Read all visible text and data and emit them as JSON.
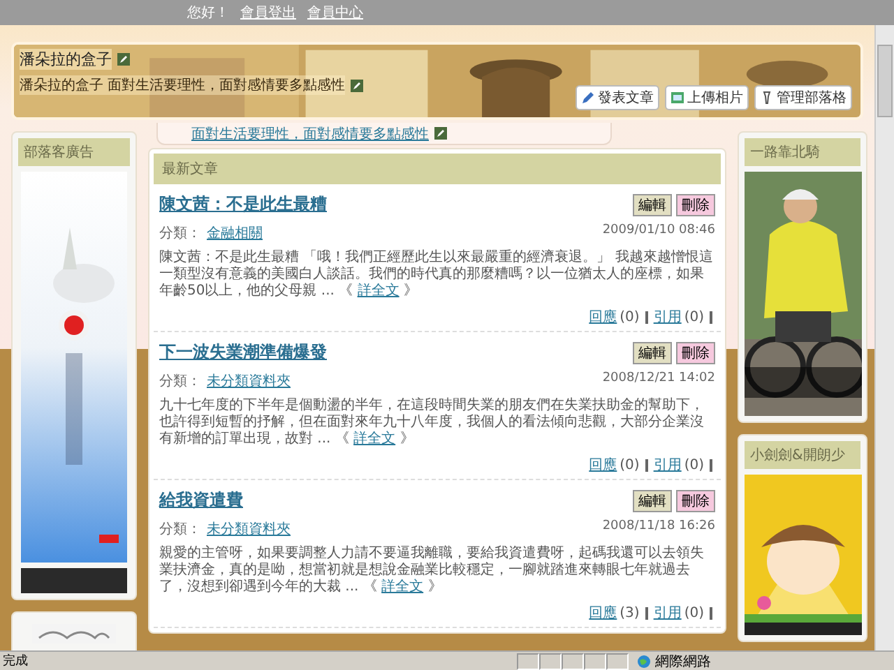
{
  "top_bar": {
    "greeting": "您好！",
    "links": [
      "會員登出",
      "會員中心"
    ]
  },
  "banner": {
    "title": "潘朵拉的盒子",
    "subtitle": "潘朵拉的盒子 面對生活要理性，面對感情要多點感性",
    "buttons": [
      {
        "label": "發表文章"
      },
      {
        "label": "上傳相片"
      },
      {
        "label": "管理部落格"
      }
    ]
  },
  "motto": {
    "link": "面對生活要理性，面對感情要多點感性"
  },
  "left_sidebar": {
    "modules": [
      {
        "title": "部落客廣告"
      }
    ]
  },
  "articles": {
    "title": "最新文章",
    "posts": [
      {
        "title": "陳文茜：不是此生最糟",
        "edit": "編輯",
        "delete": "刪除",
        "category_label": "分類：",
        "category": "金融相關",
        "date": "2009/01/10 08:46",
        "excerpt": "陳文茜：不是此生最糟 「哦！我們正經歷此生以來最嚴重的經濟衰退。」 我越來越憎恨這一類型沒有意義的美國白人談話。我們的時代真的那麼糟嗎？以一位猶太人的座標，如果年齡50以上，他的父母親 ...",
        "more_open": "《",
        "more": "詳全文",
        "more_close": "》",
        "replies": "回應",
        "reply_count": "(0)",
        "trackbacks": "引用",
        "trackback_count": "(0)"
      },
      {
        "title": "下一波失業潮準備爆發",
        "edit": "編輯",
        "delete": "刪除",
        "category_label": "分類：",
        "category": "未分類資料夾",
        "date": "2008/12/21 14:02",
        "excerpt": "九十七年度的下半年是個動盪的半年，在這段時間失業的朋友們在失業扶助金的幫助下，也許得到短暫的抒解，但在面對來年九十八年度，我個人的看法傾向悲觀，大部分企業沒有新增的訂單出現，故對 ...",
        "more_open": "《",
        "more": "詳全文",
        "more_close": "》",
        "replies": "回應",
        "reply_count": "(0)",
        "trackbacks": "引用",
        "trackback_count": "(0)"
      },
      {
        "title": "給我資遣費",
        "edit": "編輯",
        "delete": "刪除",
        "category_label": "分類：",
        "category": "未分類資料夾",
        "date": "2008/11/18 16:26",
        "excerpt": "親愛的主管呀，如果要調整人力請不要逼我離職，要給我資遣費呀，起碼我還可以去領失業扶濟金，真的是呦，想當初就是想說金融業比較穩定，一腳就踏進來轉眼七年就過去了，沒想到卻遇到今年的大裁 ...",
        "more_open": "《",
        "more": "詳全文",
        "more_close": "》",
        "replies": "回應",
        "reply_count": "(3)",
        "trackbacks": "引用",
        "trackback_count": "(0)"
      }
    ]
  },
  "right_sidebar": {
    "modules": [
      {
        "title": "一路靠北騎"
      },
      {
        "title": "小劍劍&開朗少"
      }
    ]
  },
  "status_bar": {
    "text": "完成",
    "zone": "網際網路"
  }
}
